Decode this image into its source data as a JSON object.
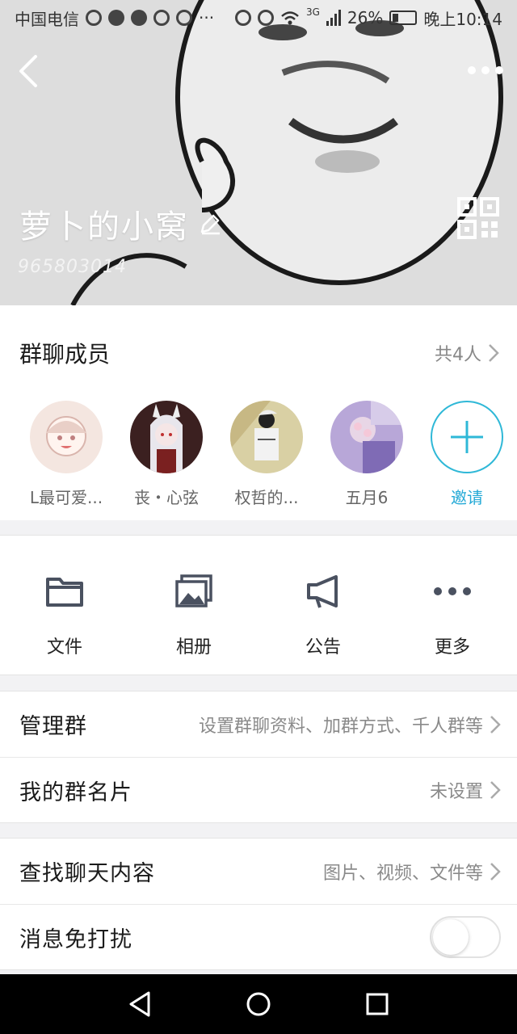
{
  "statusbar": {
    "carrier": "中国电信",
    "network": "3G",
    "battery": "26%",
    "time": "晚上10:14",
    "battery_level": 0.26
  },
  "header": {
    "group_name": "萝卜的小窝",
    "group_id": "965803014",
    "back_icon": "chevron-left-icon",
    "more_icon": "more-dots-icon",
    "qr_icon": "qr-code-icon",
    "edit_icon": "pencil-icon"
  },
  "members": {
    "title": "群聊成员",
    "count": "共4人",
    "list": [
      {
        "name": "L最可爱...",
        "color": "#f2e2dc"
      },
      {
        "name": "丧・心弦",
        "color": "#3b2020"
      },
      {
        "name": "权哲的...",
        "color": "#d8cfa8"
      },
      {
        "name": "五月6",
        "color": "#9b86c8"
      }
    ],
    "invite_label": "邀请"
  },
  "tools": [
    {
      "label": "文件",
      "icon": "folder-icon"
    },
    {
      "label": "相册",
      "icon": "album-icon"
    },
    {
      "label": "公告",
      "icon": "megaphone-icon"
    },
    {
      "label": "更多",
      "icon": "more-icon"
    }
  ],
  "rows": {
    "manage": {
      "label": "管理群",
      "value": "设置群聊资料、加群方式、千人群等"
    },
    "card": {
      "label": "我的群名片",
      "value": "未设置"
    },
    "search": {
      "label": "查找聊天内容",
      "value": "图片、视频、文件等"
    },
    "mute": {
      "label": "消息免打扰",
      "on": false
    }
  },
  "colors": {
    "accent": "#2fb8d7",
    "icon": "#4a5160"
  }
}
